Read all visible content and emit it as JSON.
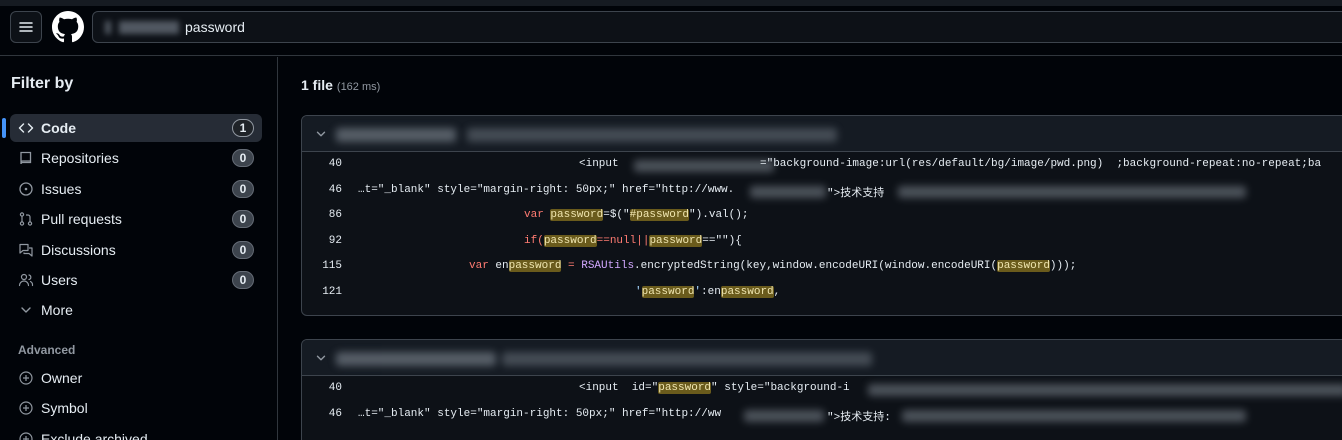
{
  "search": {
    "query": "password"
  },
  "sidebar": {
    "title": "Filter by",
    "items": [
      {
        "label": "Code",
        "count": "1",
        "icon": "code-icon"
      },
      {
        "label": "Repositories",
        "count": "0",
        "icon": "repo-icon"
      },
      {
        "label": "Issues",
        "count": "0",
        "icon": "issue-icon"
      },
      {
        "label": "Pull requests",
        "count": "0",
        "icon": "pull-request-icon"
      },
      {
        "label": "Discussions",
        "count": "0",
        "icon": "discussion-icon"
      },
      {
        "label": "Users",
        "count": "0",
        "icon": "people-icon"
      }
    ],
    "more_label": "More",
    "advanced_title": "Advanced",
    "advanced": [
      {
        "label": "Owner",
        "icon": "plus-circle-icon"
      },
      {
        "label": "Symbol",
        "icon": "plus-circle-icon"
      },
      {
        "label": "Exclude archived",
        "icon": "plus-circle-icon"
      }
    ]
  },
  "results": {
    "count": "1 file",
    "time": "(162 ms)",
    "files": [
      {
        "lines": [
          {
            "n": "40",
            "a": "<input ",
            "b": "=\"background-image:url(res/default/bg/image/pwd.png)  ;background-repeat:no-repeat;ba"
          },
          {
            "n": "46",
            "a": "…t=\"_blank\" style=\"margin-right: 50px;\" href=\"http://www.",
            "b": "\">技术支持"
          },
          {
            "n": "86",
            "kw": "var ",
            "hl": "password",
            "rest1": "=$(\"",
            "hl2": "#password",
            "rest2": "\").val();"
          },
          {
            "n": "92",
            "kw": "if(",
            "hl": "password",
            "rest1": "==null||",
            "hl2": "password",
            "rest2": "==\"\"){"
          },
          {
            "n": "115",
            "kw": "var ",
            "pre": "en",
            "hl": "password",
            "rest1": " = ",
            "fn": "RSAUtils",
            "rest2": ".encryptedString(key,window.encodeURI(window.encodeURI(",
            "hl2": "password",
            "rest3": ")));"
          },
          {
            "n": "121",
            "q1": "'",
            "hl": "password",
            "q2": "'",
            "rest1": ":en",
            "hl2": "password",
            "rest2": ","
          }
        ]
      },
      {
        "lines": [
          {
            "n": "40",
            "a": "<input  id=\"",
            "hl": "password",
            "b": "\" style=\"background-i"
          },
          {
            "n": "46",
            "a": "…t=\"_blank\" style=\"margin-right: 50px;\" href=\"http://ww",
            "b": "\">技术支持:"
          }
        ]
      }
    ]
  }
}
